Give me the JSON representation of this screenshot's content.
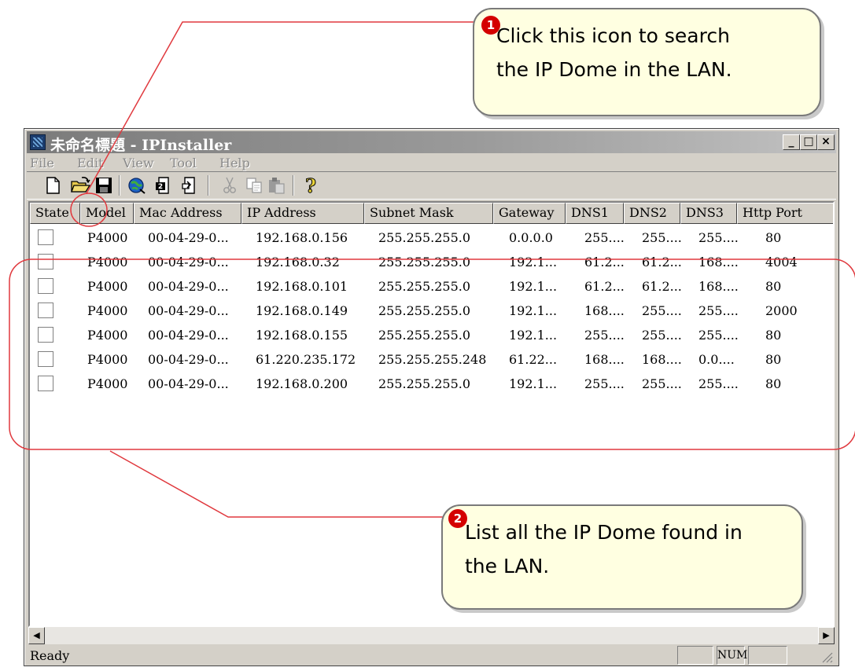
{
  "window": {
    "title": "未命名標題 - IPInstaller",
    "minimize": "_",
    "maximize": "□",
    "close": "×"
  },
  "menu": [
    "File",
    "Edit",
    "View",
    "Tool",
    "Help"
  ],
  "toolbar": {
    "buttons": [
      "new-document",
      "open-search",
      "save",
      "search-network",
      "document-a",
      "document-b",
      "cut",
      "copy",
      "paste",
      "help"
    ]
  },
  "list": {
    "columns": [
      "State",
      "Model",
      "Mac Address",
      "IP Address",
      "Subnet Mask",
      "Gateway",
      "DNS1",
      "DNS2",
      "DNS3",
      "Http Port"
    ],
    "rows": [
      [
        "P4000",
        "00-04-29-0...",
        "192.168.0.156",
        "255.255.255.0",
        "0.0.0.0",
        "255....",
        "255....",
        "255....",
        "80"
      ],
      [
        "P4000",
        "00-04-29-0...",
        "192.168.0.32",
        "255.255.255.0",
        "192.1...",
        "61.2...",
        "61.2...",
        "168....",
        "4004"
      ],
      [
        "P4000",
        "00-04-29-0...",
        "192.168.0.101",
        "255.255.255.0",
        "192.1...",
        "61.2...",
        "61.2...",
        "168....",
        "80"
      ],
      [
        "P4000",
        "00-04-29-0...",
        "192.168.0.149",
        "255.255.255.0",
        "192.1...",
        "168....",
        "255....",
        "255....",
        "2000"
      ],
      [
        "P4000",
        "00-04-29-0...",
        "192.168.0.155",
        "255.255.255.0",
        "192.1...",
        "255....",
        "255....",
        "255....",
        "80"
      ],
      [
        "P4000",
        "00-04-29-0...",
        "61.220.235.172",
        "255.255.255.248",
        "61.22...",
        "168....",
        "168....",
        "0.0....",
        "80"
      ],
      [
        "P4000",
        "00-04-29-0...",
        "192.168.0.200",
        "255.255.255.0",
        "192.1...",
        "255....",
        "255....",
        "255....",
        "80"
      ]
    ]
  },
  "scrollbar": {
    "left": "◀",
    "right": "▶"
  },
  "status": {
    "text": "Ready",
    "num": "NUM"
  },
  "callouts": [
    {
      "number": "1",
      "lines": [
        "Click this icon to search",
        "the IP Dome in the LAN."
      ]
    },
    {
      "number": "2",
      "lines": [
        "List all the IP Dome found in",
        "the LAN."
      ]
    }
  ],
  "colors": {
    "annotation": "#e0393e",
    "callout_bg": "#ffffe1",
    "title_bar": "#8a8a8a"
  }
}
